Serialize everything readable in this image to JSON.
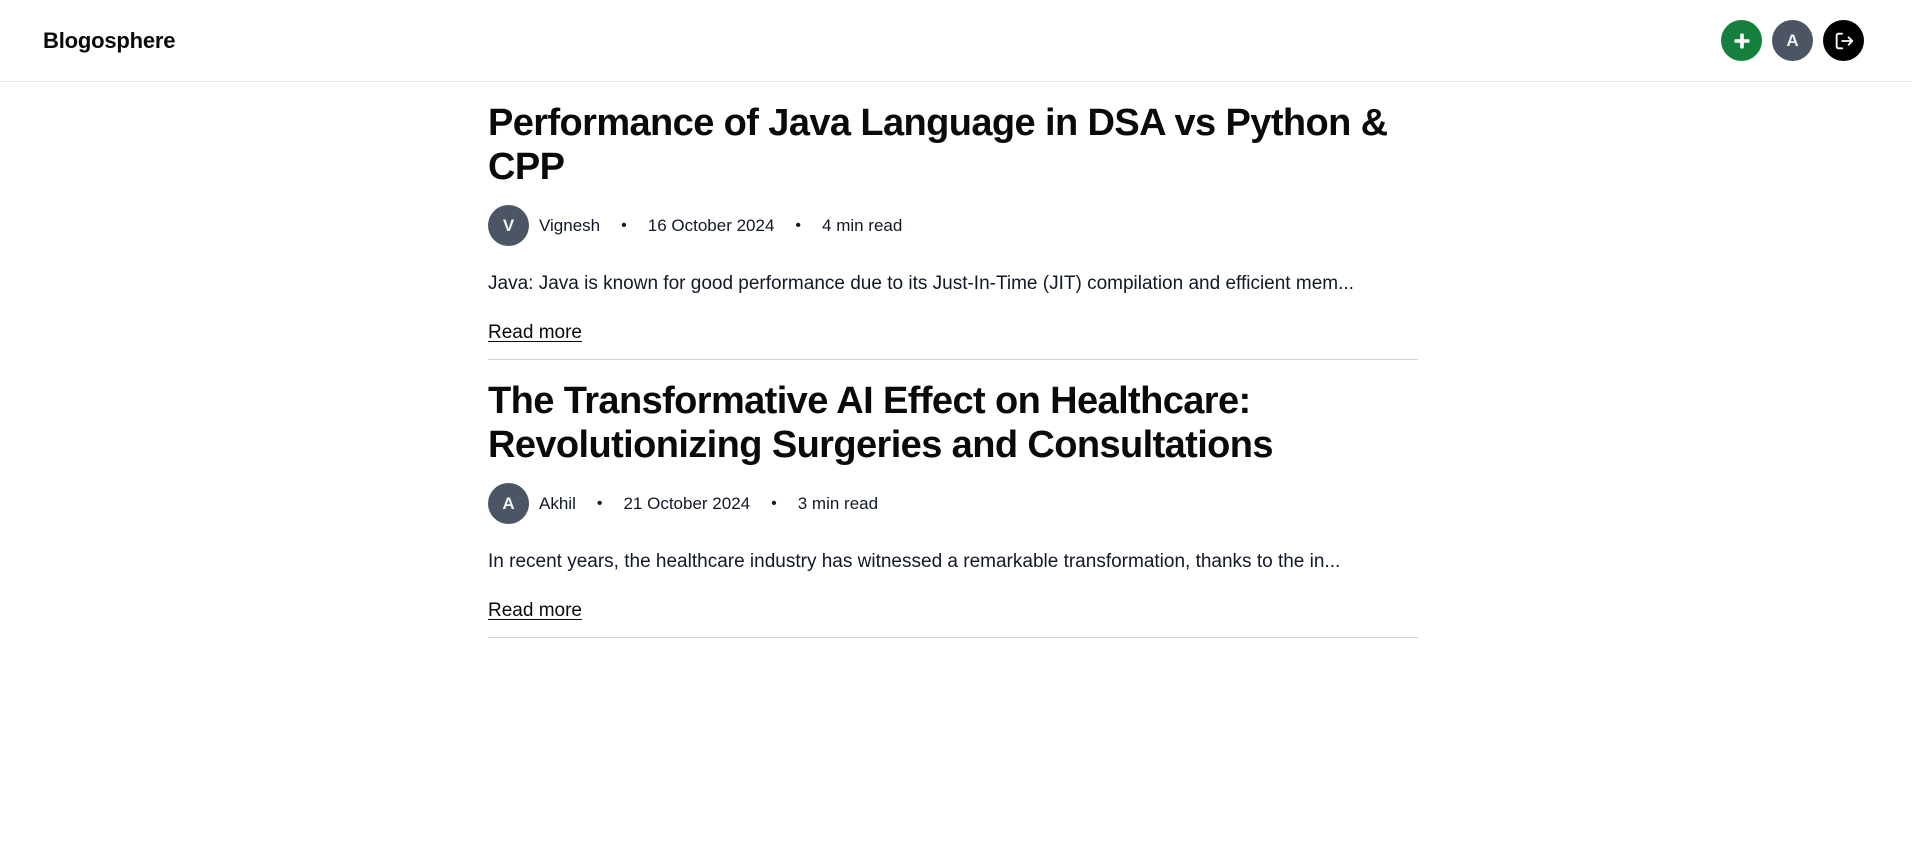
{
  "navbar": {
    "brand": "Blogosphere",
    "avatar_initial": "A",
    "colors": {
      "new_post": "#15803d",
      "avatar": "#4b5563",
      "logout": "#000000"
    },
    "icons": [
      "plus-icon",
      "logout-icon"
    ]
  },
  "posts": [
    {
      "title": "Performance of Java Language in DSA vs Python & CPP",
      "author_initial": "V",
      "author": "Vignesh",
      "date": "16 October 2024",
      "read_time": "4 min read",
      "excerpt": "Java: Java is known for good performance due to its Just-In-Time (JIT) compilation and efficient mem...",
      "read_more": "Read more"
    },
    {
      "title": "The Transformative AI Effect on Healthcare: Revolutionizing Surgeries and Consultations",
      "author_initial": "A",
      "author": "Akhil",
      "date": "21 October 2024",
      "read_time": "3 min read",
      "excerpt": "In recent years, the healthcare industry has witnessed a remarkable transformation, thanks to the in...",
      "read_more": "Read more"
    }
  ],
  "separator": "•"
}
